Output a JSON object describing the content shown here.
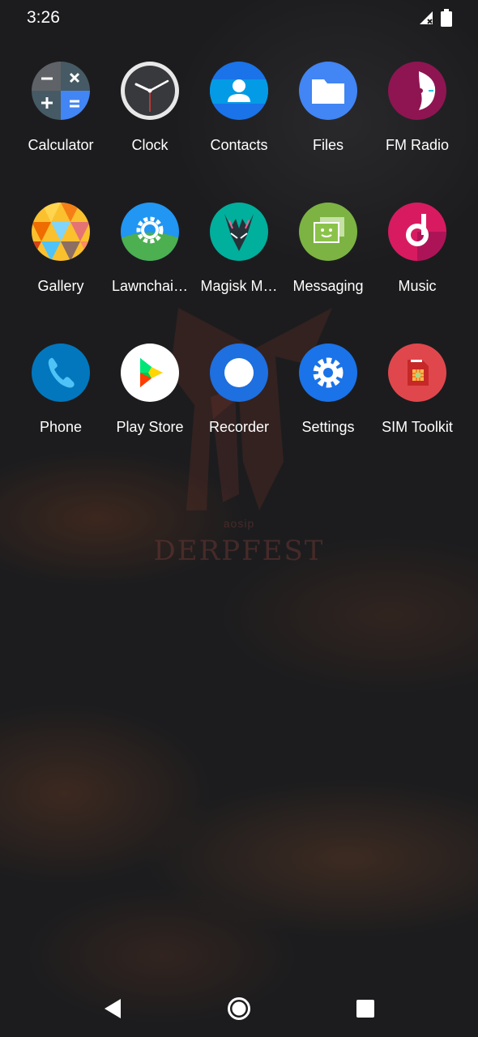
{
  "status_bar": {
    "time": "3:26",
    "signal_icon": "signal-no-sim-icon",
    "battery_icon": "battery-icon"
  },
  "apps": [
    [
      {
        "label": "Calculator",
        "icon": "calculator-icon"
      },
      {
        "label": "Clock",
        "icon": "clock-icon"
      },
      {
        "label": "Contacts",
        "icon": "contacts-icon"
      },
      {
        "label": "Files",
        "icon": "files-icon"
      },
      {
        "label": "FM Radio",
        "icon": "fm-radio-icon"
      }
    ],
    [
      {
        "label": "Gallery",
        "icon": "gallery-icon"
      },
      {
        "label": "Lawnchai…",
        "icon": "lawnchair-icon"
      },
      {
        "label": "Magisk M…",
        "icon": "magisk-icon"
      },
      {
        "label": "Messaging",
        "icon": "messaging-icon"
      },
      {
        "label": "Music",
        "icon": "music-icon"
      }
    ],
    [
      {
        "label": "Phone",
        "icon": "phone-icon"
      },
      {
        "label": "Play Store",
        "icon": "play-store-icon"
      },
      {
        "label": "Recorder",
        "icon": "recorder-icon"
      },
      {
        "label": "Settings",
        "icon": "settings-icon"
      },
      {
        "label": "SIM Toolkit",
        "icon": "sim-toolkit-icon"
      }
    ]
  ],
  "wallpaper": {
    "sub_text": "aosip",
    "brand_text": "DERPFEST"
  },
  "nav_bar": {
    "back_icon": "back-icon",
    "home_icon": "home-icon",
    "recents_icon": "recents-icon"
  }
}
